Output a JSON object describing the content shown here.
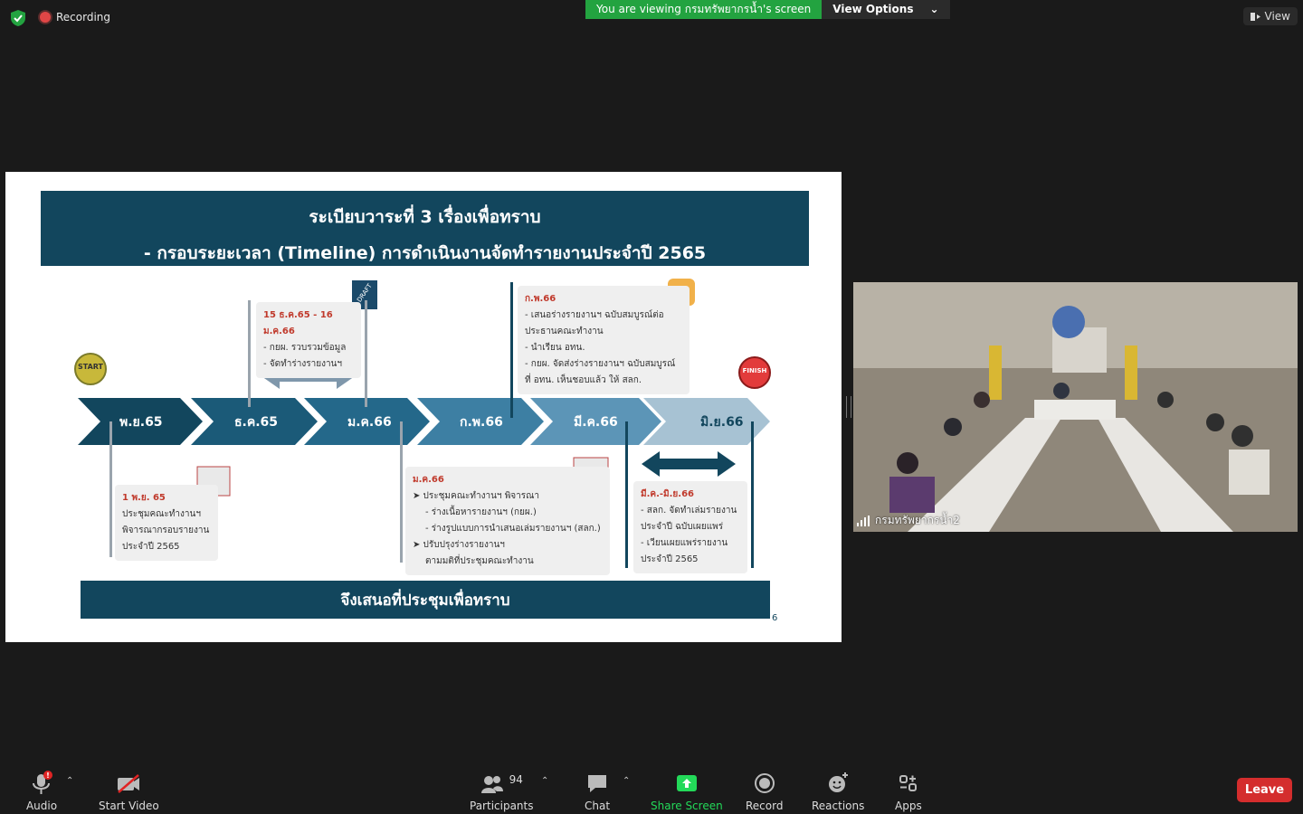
{
  "top": {
    "recording_label": "Recording",
    "viewing_message": "You are viewing กรมทรัพยากรน้ำ's screen",
    "view_options_label": "View Options",
    "view_label": "View"
  },
  "slide": {
    "title_line1": "ระเบียบวาระที่ 3 เรื่องเพื่อทราบ",
    "title_line2": "- กรอบระยะเวลา (Timeline) การดำเนินงานจัดทำรายงานประจำปี 2565",
    "start_label": "START",
    "finish_label": "FINISH",
    "draft_label": "DRAFT",
    "timeline": [
      "พ.ย.65",
      "ธ.ค.65",
      "ม.ค.66",
      "ก.พ.66",
      "มี.ค.66",
      "มิ.ย.66"
    ],
    "note_nov": {
      "head": "1 พ.ย. 65",
      "lines": [
        "ประชุมคณะทำงานฯ",
        "พิจารณากรอบรายงาน",
        "ประจำปี 2565"
      ]
    },
    "note_dec": {
      "head": "15 ธ.ค.65 - 16 ม.ค.66",
      "lines": [
        "- กยผ. รวบรวมข้อมูล",
        "- จัดทำร่างรายงานฯ"
      ]
    },
    "note_jan": {
      "head": "ม.ค.66",
      "lines": [
        "➤ ประชุมคณะทำงานฯ พิจารณา",
        "- ร่างเนื้อหารายงานฯ (กยผ.)",
        "- ร่างรูปแบบการนำเสนอเล่มรายงานฯ (สลก.)",
        "➤ ปรับปรุงร่างรายงานฯ",
        "ตามมติที่ประชุมคณะทำงาน"
      ]
    },
    "note_feb": {
      "head": "ก.พ.66",
      "lines": [
        "- เสนอร่างรายงานฯ ฉบับสมบูรณ์ต่อ",
        "ประธานคณะทำงาน",
        "- นำเรียน อทน.",
        "- กยผ. จัดส่งร่างรายงานฯ ฉบับสมบูรณ์",
        "ที่ อทน. เห็นชอบแล้ว ให้ สลก."
      ]
    },
    "note_mar": {
      "head": "มี.ค.-มิ.ย.66",
      "lines": [
        "- สลก. จัดทำเล่มรายงาน",
        "ประจำปี ฉบับเผยแพร่",
        "- เวียนเผยแพร่รายงาน",
        "ประจำปี 2565"
      ]
    },
    "footer": "จึงเสนอที่ประชุมเพื่อทราบ",
    "page_number": "6"
  },
  "video": {
    "participant_name": "กรมทรัพยากรน้ำ2"
  },
  "toolbar": {
    "audio": "Audio",
    "start_video": "Start Video",
    "participants": "Participants",
    "participants_count": "94",
    "chat": "Chat",
    "share_screen": "Share Screen",
    "record": "Record",
    "reactions": "Reactions",
    "apps": "Apps",
    "leave": "Leave"
  },
  "colors": {
    "slide_navy": "#12465d",
    "share_green": "#23d959",
    "leave_red": "#d42d2d",
    "banner_green": "#23a340"
  }
}
